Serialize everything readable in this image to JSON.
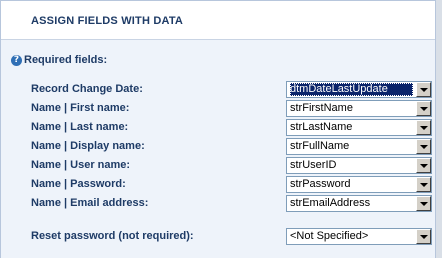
{
  "section": {
    "title": "ASSIGN FIELDS WITH DATA",
    "required_label": "Required fields:",
    "help_glyph": "?"
  },
  "fields": [
    {
      "label": "Record Change Date:",
      "value": "dtmDateLastUpdate"
    },
    {
      "label": "Name | First name:",
      "value": "strFirstName"
    },
    {
      "label": "Name | Last name:",
      "value": "strLastName"
    },
    {
      "label": "Name | Display name:",
      "value": "strFullName"
    },
    {
      "label": "Name | User name:",
      "value": "strUserID"
    },
    {
      "label": "Name | Password:",
      "value": "strPassword"
    },
    {
      "label": "Name | Email address:",
      "value": "strEmailAddress"
    }
  ],
  "optional_field": {
    "label": "Reset password (not required):",
    "value": "<Not Specified>"
  },
  "colors": {
    "label_text": "#1e3b66",
    "panel_bg": "#eef3fa",
    "focus_bg": "#0a246a"
  }
}
